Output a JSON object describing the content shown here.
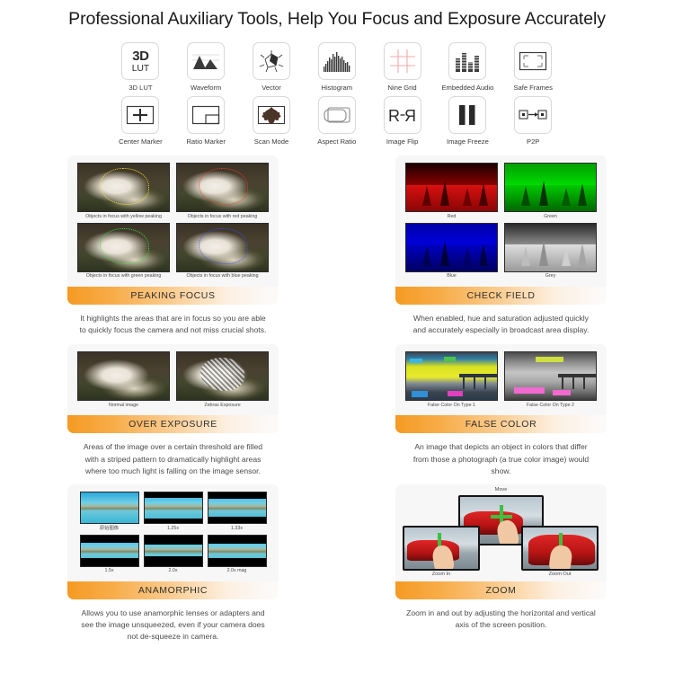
{
  "header": {
    "title": "Professional Auxiliary Tools, Help You Focus and Exposure Accurately"
  },
  "icon_grid": {
    "items": [
      {
        "label": "3D LUT",
        "icon": "3d-lut-icon",
        "glyph_top": "3D",
        "glyph_bottom": "LUT"
      },
      {
        "label": "Waveform",
        "icon": "waveform-icon"
      },
      {
        "label": "Vector",
        "icon": "vector-scope-icon"
      },
      {
        "label": "Histogram",
        "icon": "histogram-icon"
      },
      {
        "label": "Nine Grid",
        "icon": "nine-grid-icon"
      },
      {
        "label": "Embedded Audio",
        "icon": "embedded-audio-icon"
      },
      {
        "label": "Safe Frames",
        "icon": "safe-frames-icon"
      },
      {
        "label": "Center Marker",
        "icon": "center-marker-icon"
      },
      {
        "label": "Ratio Marker",
        "icon": "ratio-marker-icon"
      },
      {
        "label": "Scan Mode",
        "icon": "scan-mode-icon"
      },
      {
        "label": "Aspect Ratio",
        "icon": "aspect-ratio-icon"
      },
      {
        "label": "Image Flip",
        "icon": "image-flip-icon",
        "glyph": "R-Я"
      },
      {
        "label": "Image Freeze",
        "icon": "image-freeze-icon"
      },
      {
        "label": "P2P",
        "icon": "p2p-icon"
      }
    ]
  },
  "colors": {
    "banner_start": "#f59a23",
    "banner_end": "#fbfbfb",
    "card_bg": "#f7f7f7",
    "page_bg": "#ffffff",
    "nine_grid_line": "#f3a9a9"
  },
  "cards": [
    {
      "name": "peaking-focus",
      "banner": "PEAKING FOCUS",
      "description": "It highlights the areas that are in focus so you are able to quickly focus the camera and not miss crucial shots.",
      "thumbs": [
        {
          "caption": "Objects in focus with yellow peaking"
        },
        {
          "caption": "Objects in focus with red peaking"
        },
        {
          "caption": "Objects in focus with green peaking"
        },
        {
          "caption": "Objects in focus with blue peaking"
        }
      ]
    },
    {
      "name": "check-field",
      "banner": "CHECK FIELD",
      "description": "When enabled,  hue and saturation adjusted quickly and accurately especially in broadcast area display.",
      "thumbs": [
        {
          "caption": "Red"
        },
        {
          "caption": "Green"
        },
        {
          "caption": "Blue"
        },
        {
          "caption": "Grey"
        }
      ]
    },
    {
      "name": "over-exposure",
      "banner": "OVER EXPOSURE",
      "description": "Areas of the image over a certain threshold are filled with a striped pattern to dramatically highlight areas where too much light is falling  on the image sensor.",
      "thumbs": [
        {
          "caption": "Normal image"
        },
        {
          "caption": "Zebras Exposure"
        }
      ]
    },
    {
      "name": "false-color",
      "banner": "FALSE COLOR",
      "description": "An image that depicts an object in colors that differ from those a photograph (a true color image) would show.",
      "thumbs": [
        {
          "caption": "False Color On Type 1"
        },
        {
          "caption": "False Color On Type 2"
        }
      ]
    },
    {
      "name": "anamorphic",
      "banner": "ANAMORPHIC",
      "description": "Allows you to use anamorphic lenses or adapters and see the image unsqueezed, even if your camera does not de-squeeze in camera.",
      "thumbs": [
        {
          "caption": "原始图像"
        },
        {
          "caption": "1.25x"
        },
        {
          "caption": "1.33x"
        },
        {
          "caption": "1.5x"
        },
        {
          "caption": "2.0x"
        },
        {
          "caption": "2.0x mag"
        }
      ]
    },
    {
      "name": "zoom",
      "banner": "ZOOM",
      "description": "Zoom in and out by adjusting the horizontal and vertical axis of the screen position.",
      "thumbs": [
        {
          "caption": "Move"
        },
        {
          "caption": "Zoom In"
        },
        {
          "caption": "Zoom Out"
        }
      ]
    }
  ]
}
